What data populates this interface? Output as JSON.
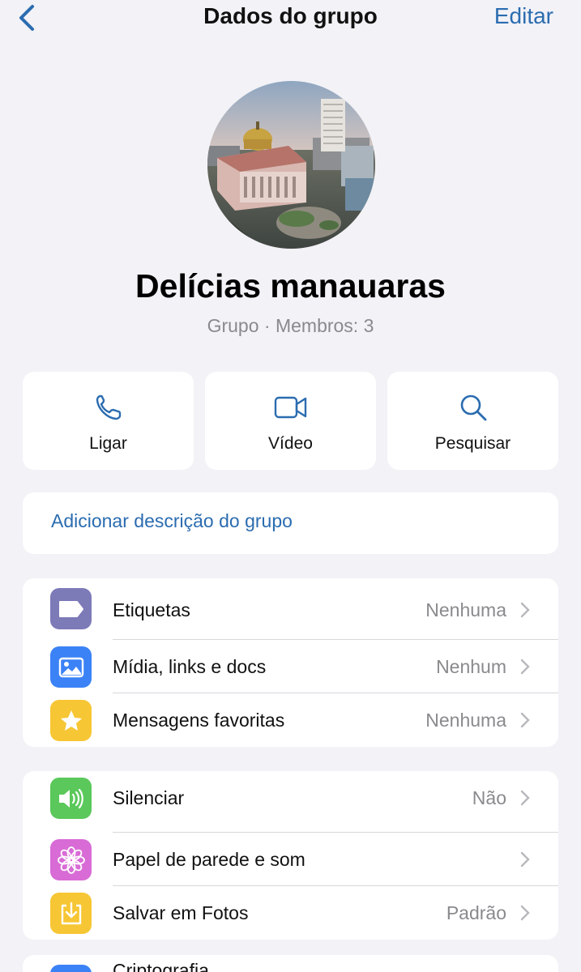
{
  "nav": {
    "title": "Dados do grupo",
    "edit_label": "Editar"
  },
  "group": {
    "name": "Delícias manauaras",
    "subtitle": "Grupo · Membros: 3"
  },
  "actions": [
    {
      "label": "Ligar",
      "icon": "phone-icon"
    },
    {
      "label": "Vídeo",
      "icon": "video-icon"
    },
    {
      "label": "Pesquisar",
      "icon": "search-icon"
    }
  ],
  "description": {
    "label": "Adicionar descrição do grupo"
  },
  "section1": [
    {
      "title": "Etiquetas",
      "value": "Nenhuma",
      "icon": "tag-icon",
      "color": "#7d7ab8"
    },
    {
      "title": "Mídia, links e docs",
      "value": "Nenhum",
      "icon": "photo-icon",
      "color": "#3b82f6"
    },
    {
      "title": "Mensagens favoritas",
      "value": "Nenhuma",
      "icon": "star-icon",
      "color": "#f7c634"
    }
  ],
  "section2": [
    {
      "title": "Silenciar",
      "value": "Não",
      "icon": "speaker-icon",
      "color": "#5ac85a"
    },
    {
      "title": "Papel de parede e som",
      "value": "",
      "icon": "flower-icon",
      "color": "#d86bd6"
    },
    {
      "title": "Salvar em Fotos",
      "value": "Padrão",
      "icon": "save-download-icon",
      "color": "#f7c634"
    }
  ],
  "section3": [
    {
      "title": "Criptografia",
      "icon": "lock-icon",
      "color": "#3b82f6"
    }
  ],
  "colors": {
    "accent": "#2b6cb0",
    "background": "#f2f2f7",
    "secondary_text": "#8a8a8e"
  }
}
